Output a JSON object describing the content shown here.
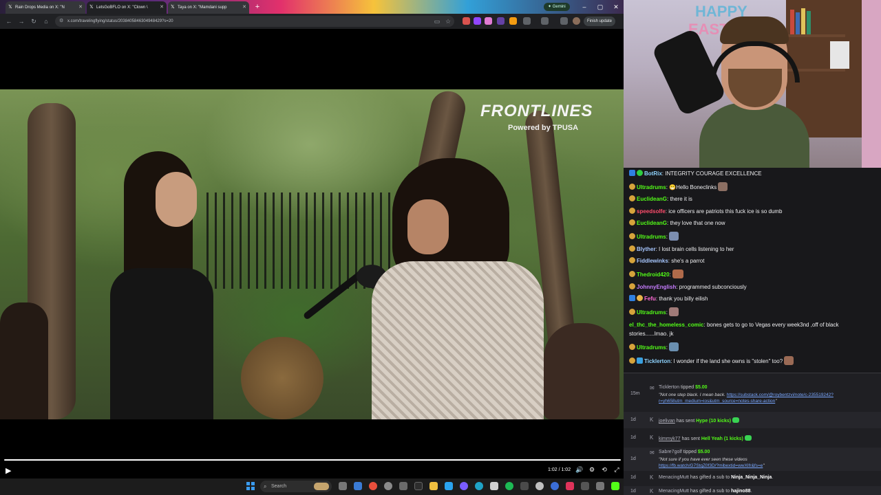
{
  "browser": {
    "tabs": [
      {
        "title": "Rain Drops Media on X: \"N"
      },
      {
        "title": "LetsGoBFLO on X: \"Clown \\"
      },
      {
        "title": "Taya on X: \"Mamdani supp"
      }
    ],
    "gemini_label": "Gemini",
    "url": "x.com/travelingflying/status/2038405846304948429?s=20",
    "finish_update_label": "Finish update"
  },
  "video": {
    "brand_title": "FRONTLINES",
    "brand_subtitle": "Powered by  TPUSA",
    "timecode": "1:02 / 1:02",
    "progress": 1.0
  },
  "taskbar": {
    "search_placeholder": "Search"
  },
  "webcam": {
    "sign_line1": "HAPPY",
    "sign_line2": "EASTE"
  },
  "chat": {
    "messages": [
      {
        "user": "BotRix",
        "text": ": INTEGRITY COURAGE EXCELLENCE",
        "color": "#8fd4ff"
      },
      {
        "user": "Ultradrums",
        "text": ": 😁Hello Boneclinks",
        "color": "#53fc18"
      },
      {
        "user": "EuclideanG",
        "text": ": there it is",
        "color": "#53fc18"
      },
      {
        "user": "speedsolfe",
        "text": ": ice officers are patriots this fuck ice is so dumb",
        "color": "#ff4d6d"
      },
      {
        "user": "EuclideanG",
        "text": ": they love that one now",
        "color": "#53fc18"
      },
      {
        "user": "Ultradrums",
        "text": ":",
        "color": "#53fc18"
      },
      {
        "user": "Blyther",
        "text": ": I lost brain cells listening to her",
        "color": "#a8c7ff"
      },
      {
        "user": "Fiddlewinks",
        "text": ": she's a parrot",
        "color": "#a8c7ff"
      },
      {
        "user": "Thedroid420",
        "text": ":",
        "color": "#53fc18"
      },
      {
        "user": "JohnnyEnglish",
        "text": ": programmed subconciously",
        "color": "#c77dff"
      },
      {
        "user": "Fefu",
        "text": ": thank you billy eilish",
        "color": "#ff6bd6"
      },
      {
        "user": "Ultradrums",
        "text": ":",
        "color": "#53fc18"
      },
      {
        "user": "el_thc_the_homeless_comic",
        "text": ": bones gets to go to Vegas every week3nd ,off of black",
        "color": "#53fc18"
      },
      {
        "user": "",
        "text": "stories......lmao. jk",
        "color": "#efeff1"
      },
      {
        "user": "Ultradrums",
        "text": ":",
        "color": "#53fc18"
      },
      {
        "user": "Ticklerton",
        "text": ": I wonder if the land she owns is \"stolen\" too?",
        "color": "#8fd4ff"
      }
    ]
  },
  "events": {
    "items": [
      {
        "age": "15m",
        "who": "Ticklerton",
        "action": " tipped ",
        "amount": "$5.00",
        "note": "\"Not one step black. I mean back. ",
        "link": "https://substack.com/@roybentzvi/note/c-235519242?",
        "link2": "r=yh658utm_medium=ios&utm_source=notes-share-action",
        "note_end": "\""
      },
      {
        "age": "1d",
        "who": "joelivan",
        "action": " has sent ",
        "amount": "Hype (10 kicks)"
      },
      {
        "age": "1d",
        "who": "kimmyk77",
        "action": " has sent ",
        "amount": "Hell Yeah (1 kicks)"
      },
      {
        "age": "1d",
        "who": "Sabre7golf",
        "action": " tipped ",
        "amount": "$5.00",
        "note": "\"Not sure if you have ever seen these videos",
        "link": "https://fb.watch/G7StqZ0f3D/?mibextid=wwXIfr&fs=e",
        "note_end": "\""
      },
      {
        "age": "1d",
        "who": "MenacingMutt",
        "action": " has gifted a sub to ",
        "target": "Ninja_Ninja_Ninja",
        "end": "."
      },
      {
        "age": "1d",
        "who": "MenacingMutt",
        "action": " has gifted a sub to ",
        "target": "hajino88",
        "end": "."
      }
    ]
  }
}
